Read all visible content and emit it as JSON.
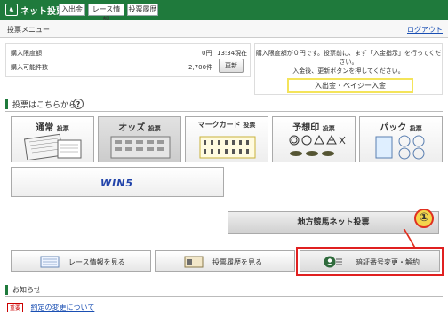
{
  "header": {
    "brand": "ネット投票",
    "nav": [
      "入出金",
      "レース情報",
      "投票履歴"
    ]
  },
  "menu": {
    "title": "投票メニュー",
    "logout": "ログアウト"
  },
  "limits": {
    "purchase_limit_label": "購入限度額",
    "purchase_limit_value": "0円",
    "as_of": "13:34現在",
    "purchasable_count_label": "購入可能件数",
    "purchasable_count_value": "2,700件",
    "refresh_label": "更新"
  },
  "notice": {
    "line1": "購入限度額が０円です。投票前に、まず「入金指示」を行ってくだ",
    "line2": "さい。",
    "line3": "入金後、更新ボタンを押してください。",
    "deposit_button": "入出金・ペイジー入金"
  },
  "vote_section": {
    "title": "投票はこちらから",
    "help": "?",
    "bet_types": [
      {
        "name": "通常",
        "suffix": "投票"
      },
      {
        "name": "オッズ",
        "suffix": "投票"
      },
      {
        "name": "マークカード",
        "suffix": "投票"
      },
      {
        "name": "予想印",
        "suffix": "投票"
      },
      {
        "name": "パック",
        "suffix": "投票"
      }
    ],
    "win5": "WIN5"
  },
  "chihou_button": "地方競馬ネット投票",
  "callout_number": "①",
  "bottom_buttons": {
    "race_info": "レース情報を見る",
    "history": "投票履歴を見る",
    "pin_change": "暗証番号変更・解約"
  },
  "news": {
    "title": "お知らせ",
    "tag": "重要",
    "link": "約定の変更について"
  },
  "colors": {
    "header_green": "#1f7a3c",
    "highlight_red": "#e02020",
    "deposit_border": "#f4e45a"
  }
}
